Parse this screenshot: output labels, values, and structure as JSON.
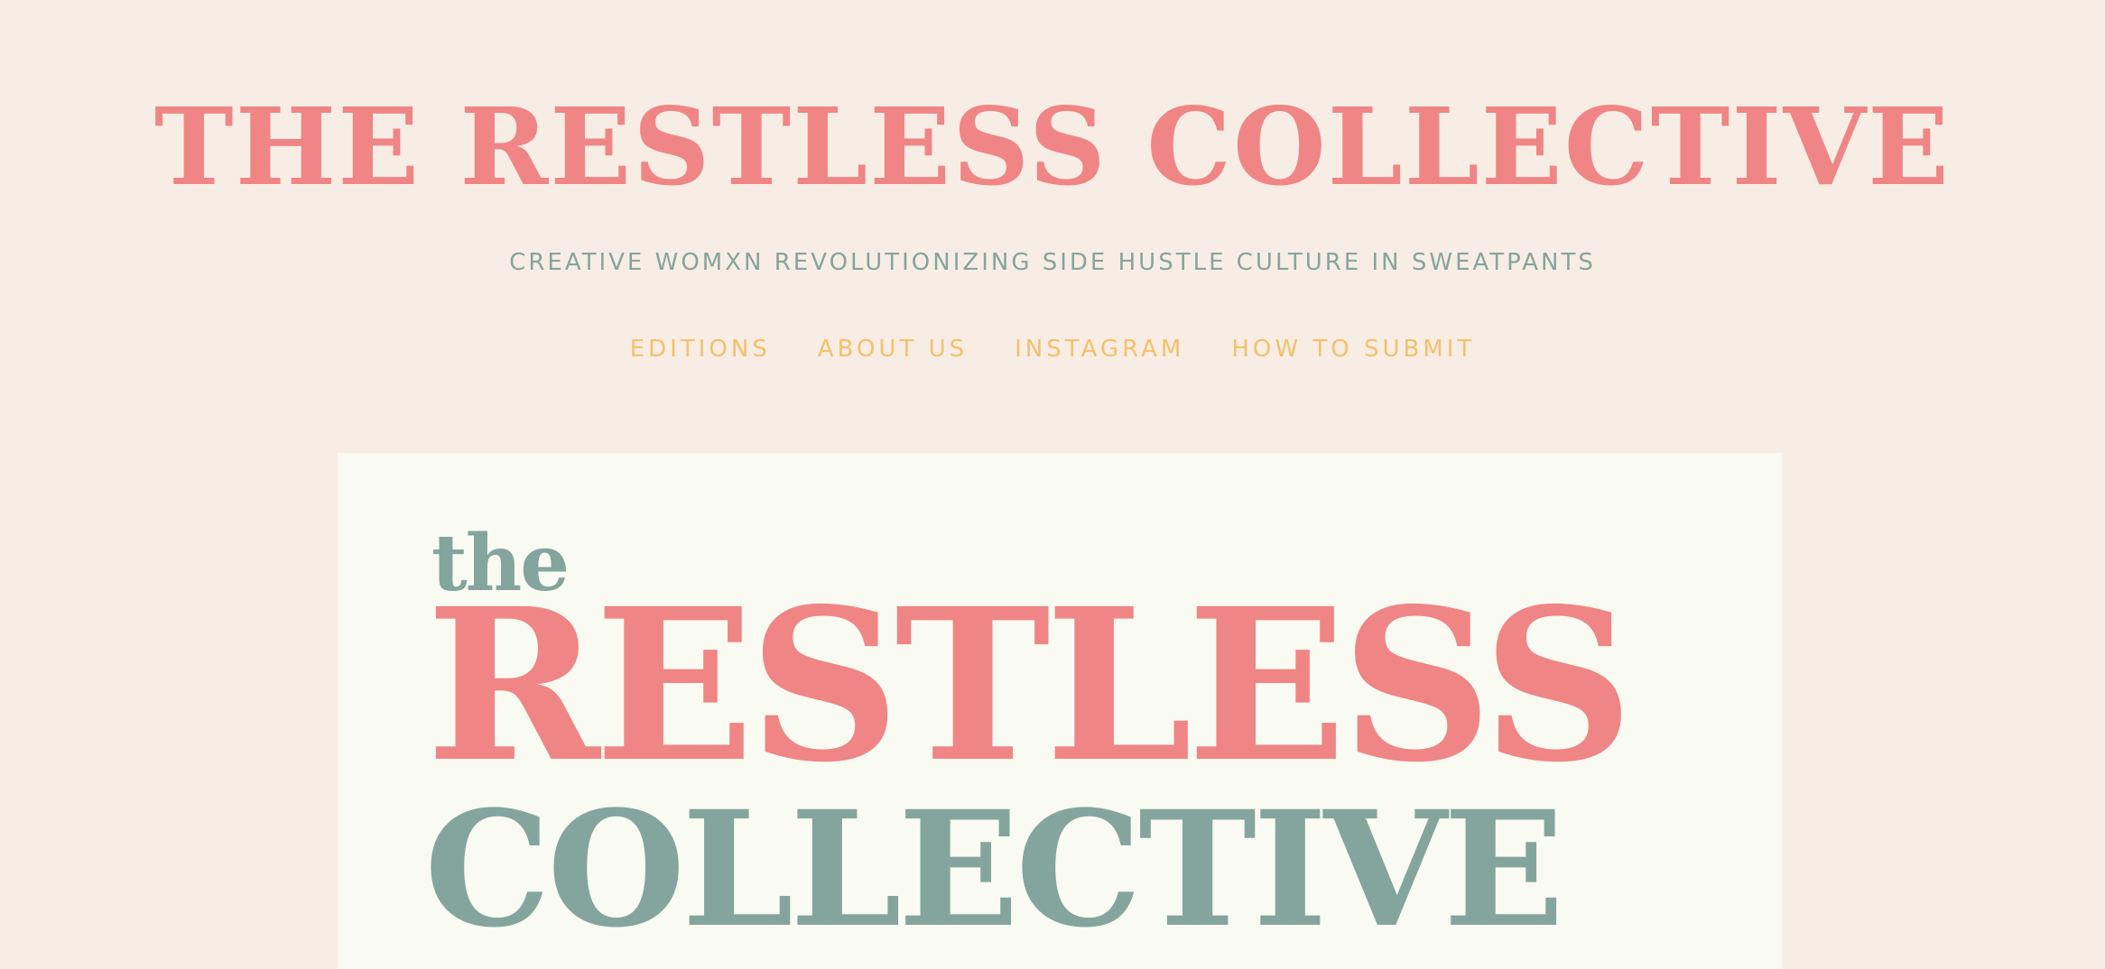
{
  "header": {
    "site_title": "THE RESTLESS COLLECTIVE",
    "tagline": "CREATIVE WOMXN REVOLUTIONIZING SIDE HUSTLE CULTURE IN SWEATPANTS"
  },
  "nav": {
    "items": [
      {
        "label": "EDITIONS"
      },
      {
        "label": "ABOUT US"
      },
      {
        "label": "INSTAGRAM"
      },
      {
        "label": "HOW TO SUBMIT"
      }
    ]
  },
  "hero_logo": {
    "line_the": "the",
    "line_restless": "RESTLESS",
    "line_collective": "COLLECTIVE"
  },
  "colors": {
    "background": "#f8ede4",
    "coral": "#f08585",
    "sage": "#84a59d",
    "mustard": "#f5c06b",
    "hero_bg": "#f9faf1"
  }
}
